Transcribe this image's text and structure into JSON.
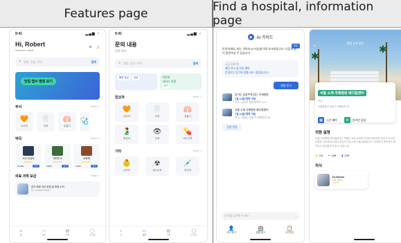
{
  "headers": {
    "left": "Features page",
    "right": "Find a hospital, information page"
  },
  "phone1": {
    "time": "9:41",
    "greeting": "Hi, Robert",
    "greeting_sub": "Welcome back!",
    "search_placeholder": "병원, 증상, 지역",
    "search_btn": "검색",
    "banner_pill": "당일 접수 병원 보기",
    "sec1": "부서",
    "sec1_more": "More >",
    "departments": [
      {
        "label": "소아과",
        "icon": "🧡"
      },
      {
        "label": "치과",
        "icon": "🦷"
      },
      {
        "label": "호흡기",
        "icon": "🫁"
      },
      {
        "label": "위",
        "icon": "🩺"
      }
    ],
    "sec2": "약국",
    "sec2_more": "More >",
    "pharmacy": [
      {
        "name": "소아 건강약",
        "stars": "★★★★☆",
        "price": "12,000",
        "btn": "담기"
      },
      {
        "name": "비타민 B",
        "stars": "★★★★★",
        "price": "9,800",
        "btn": "담기"
      },
      {
        "name": "소화제",
        "stars": "★★★★☆",
        "price": "7,500",
        "btn": "담기"
      }
    ],
    "sec3": "의료 과학 보급",
    "sec3_more": "More >",
    "news_title": "감기 예방 관리 방법 및 위생 수칙",
    "news_sub": "Dr. Lesam Rowie",
    "tabs": [
      "홈",
      "상담",
      "기록",
      "내 정보"
    ]
  },
  "phone2": {
    "time": "9:41",
    "title": "문의 내용",
    "title_sub": "진료 안내",
    "search_placeholder": "병원, 증상, 지역",
    "search_btn": "검색",
    "quick_a": "빠른 상담",
    "quick_a_tag": "상담",
    "quick_b_line1": "의료비",
    "quick_b_line2": "서비스 지원",
    "quick_b_tag": "보기",
    "sec1": "임상과",
    "sec1_more": "More >",
    "row1": [
      {
        "label": "소아과",
        "icon": "🧡"
      },
      {
        "label": "치과",
        "icon": "🦷"
      },
      {
        "label": "호흡기",
        "icon": "🫁"
      }
    ],
    "row2": [
      {
        "label": "위장과",
        "icon": "🫃"
      },
      {
        "label": "안과",
        "icon": "👁"
      },
      {
        "label": "비뇨기과",
        "icon": "💊"
      }
    ],
    "sec2": "기타",
    "sec2_more": "More >",
    "row3": [
      {
        "label": "산모과",
        "icon": "👶"
      },
      {
        "label": "방사선과",
        "icon": "☢"
      },
      {
        "label": "부인과",
        "icon": "💉"
      }
    ],
    "tabs": [
      "홈",
      "상담",
      "기록",
      "내 정보"
    ]
  },
  "phone3": {
    "ai_title": "AI 가이드",
    "ai_badge": "상담",
    "greeting": "안녕하세요, 저는 귀하의 AI 지능형 의료 보조원입니다. 다음과 같이 질문하실 수 있습니다",
    "qlabel": "궁금 상황 예",
    "q1": "재단 의사 및 진료 예약",
    "q2": "돈암모는 감기에 걸렸나요? 일었습니다?",
    "find_btn": "병원 찾기",
    "hosp1_name": "강기도 남양주에 있는 우애병원",
    "hosp1_dist": "7일 24일 예약 가능",
    "hosp1_addr": "주소: 남양주 한양대학로 123",
    "hosp2_name": "서울 소재 국제병원 메디컬센터",
    "hosp2_dist": "7일 24일 예약 가능",
    "hosp2_addr": "주소: 서울시 강남구 테헤란로 45",
    "refresh": "답변 변경",
    "input_placeholder": "문의를 입력해 주세요",
    "nav": [
      {
        "label": "의사 찾기",
        "icon": "👤"
      },
      {
        "label": "병원 찾기",
        "icon": "🏥"
      },
      {
        "label": "자가진단",
        "icon": "📋"
      }
    ]
  },
  "phone4": {
    "hero_title": "병원 상세 정보",
    "hospital_name": "서울 소재 국제병원 메디컬센터",
    "addr_label": "위치",
    "addr": "서울특별시 강남구 테헤란로 45",
    "action1": "시간 예약",
    "action2": "온라인 상담",
    "sec_desc": "의원 설명",
    "desc": "서울 국제병원 메디컬센터는 최첨단 의료 장비와 우수한 의료진을 갖추고 있으며, 다양한 진료과에서 환자 중심의 진료 서비스를 제공합니다. 언제든지 편리하게 예약하고 상담을 받으실 수 있습니다.",
    "rating": "4.8",
    "hearts": "188",
    "count": "245",
    "sec_doc": "의사",
    "doc_name": "Dr.Edene",
    "doc_sub": "내과 전문의",
    "doc_pct": "100%"
  }
}
